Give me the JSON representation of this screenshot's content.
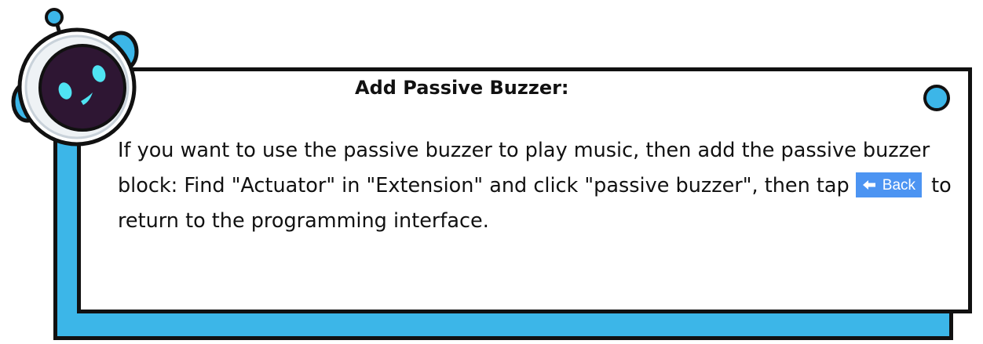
{
  "card": {
    "title": "Add Passive Buzzer:",
    "line1": "If you want to use the passive buzzer to play music, then add the passive buzzer",
    "line2_before": "block: Find \"Actuator\" in \"Extension\" and click \"passive buzzer\", then tap ",
    "line2_after": " to",
    "line3": "return to the programming interface."
  },
  "back_button": {
    "label": "Back",
    "icon": "arrow-left-icon",
    "color": "#4c94f2"
  },
  "colors": {
    "accent": "#3cb6e8",
    "border": "#111111",
    "robot_face": "#2e1633",
    "robot_eyes": "#4fe3f2"
  },
  "mascot": {
    "icon": "robot-mascot-icon"
  }
}
